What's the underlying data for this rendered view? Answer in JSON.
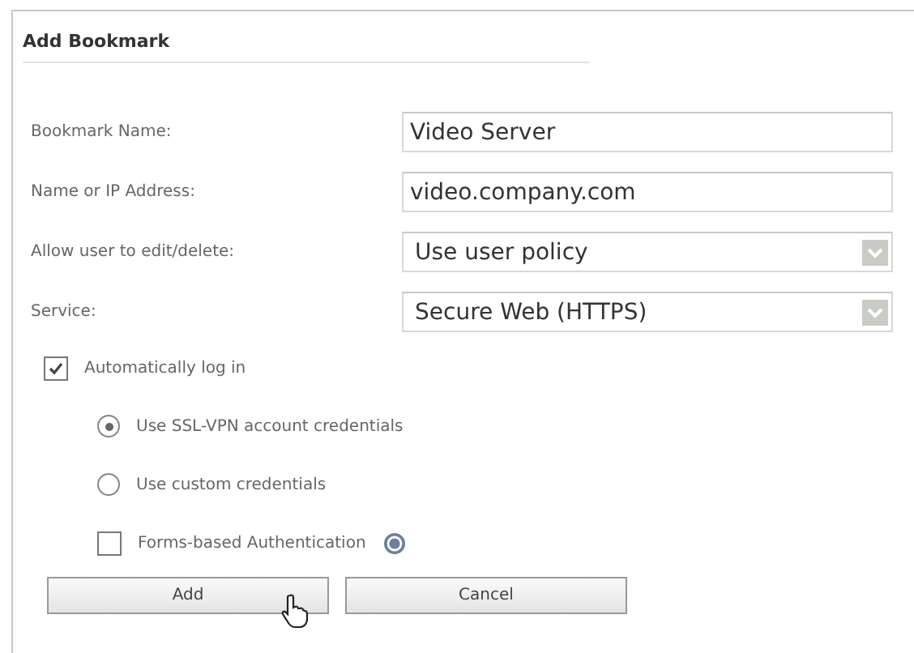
{
  "panel": {
    "title": "Add Bookmark"
  },
  "fields": [
    {
      "label": "Bookmark Name:",
      "kind": "text",
      "value": "Video Server"
    },
    {
      "label": "Name or IP Address:",
      "kind": "text",
      "value": "video.company.com"
    },
    {
      "label": "Allow user to edit/delete:",
      "kind": "select",
      "value": "Use user policy"
    },
    {
      "label": "Service:",
      "kind": "select",
      "value": "Secure Web (HTTPS)"
    }
  ],
  "auto_login": {
    "label": "Automatically log in",
    "checked": true
  },
  "credentials": [
    {
      "label": "Use SSL-VPN account credentials",
      "selected": true
    },
    {
      "label": "Use custom credentials",
      "selected": false
    }
  ],
  "forms_auth": {
    "label": "Forms-based Authentication",
    "checked": false
  },
  "buttons": [
    {
      "label": "Add"
    },
    {
      "label": "Cancel"
    }
  ]
}
